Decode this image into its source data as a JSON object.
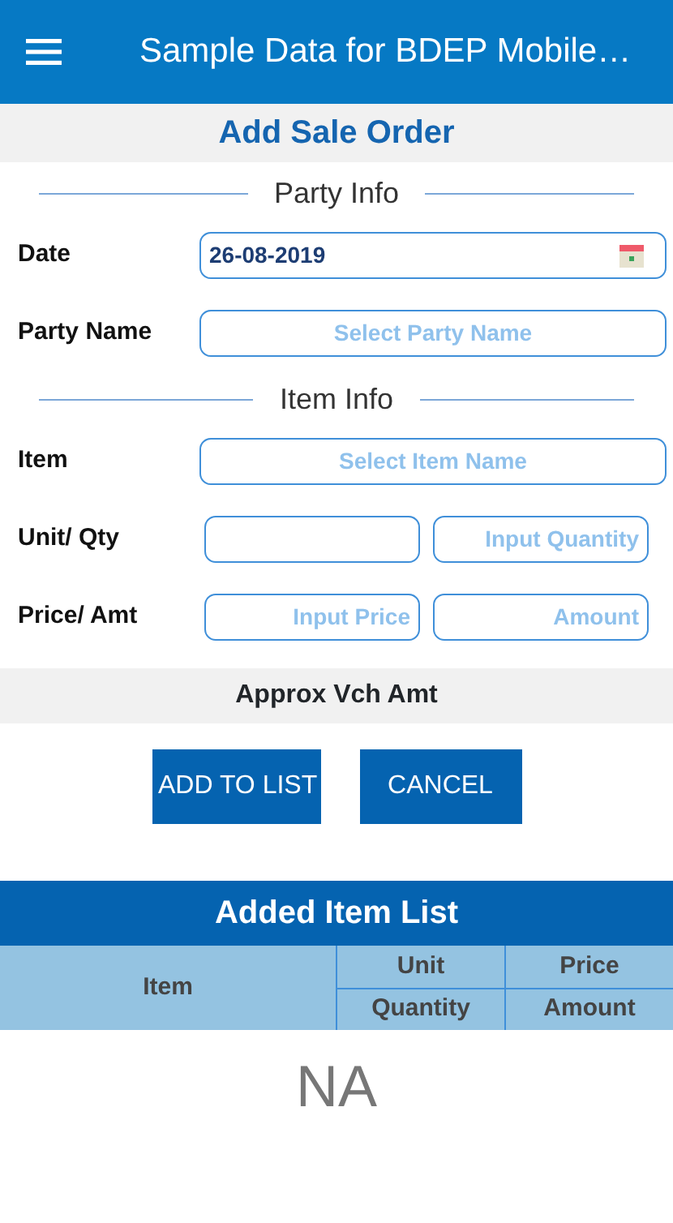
{
  "app_bar": {
    "title": "Sample Data for BDEP Mobile…"
  },
  "page_title": "Add Sale Order",
  "sections": [
    {
      "title": "Party Info",
      "rows": [
        {
          "label": "Date",
          "fields": [
            {
              "kind": "date",
              "value": "26-08-2019"
            }
          ]
        },
        {
          "label": "Party Name",
          "fields": [
            {
              "kind": "select",
              "placeholder": "Select Party Name"
            }
          ]
        }
      ]
    },
    {
      "title": "Item Info",
      "rows": [
        {
          "label": "Item",
          "fields": [
            {
              "kind": "select",
              "placeholder": "Select Item Name"
            }
          ]
        },
        {
          "label": "Unit/ Qty",
          "fields": [
            {
              "kind": "input"
            },
            {
              "kind": "input",
              "placeholder": "Input Quantity"
            }
          ]
        },
        {
          "label": "Price/ Amt",
          "fields": [
            {
              "kind": "input",
              "placeholder": "Input Price"
            },
            {
              "kind": "input",
              "placeholder": "Amount"
            }
          ]
        }
      ]
    }
  ],
  "summary": "Approx Vch Amt",
  "buttons": [
    "ADD TO LIST",
    "CANCEL"
  ],
  "item_list": {
    "title": "Added Item List",
    "columns": [
      {
        "labels": [
          "Item"
        ]
      },
      {
        "labels": [
          "Unit",
          "Quantity"
        ]
      },
      {
        "labels": [
          "Price",
          "Amount"
        ]
      }
    ],
    "empty_text": "NA"
  }
}
